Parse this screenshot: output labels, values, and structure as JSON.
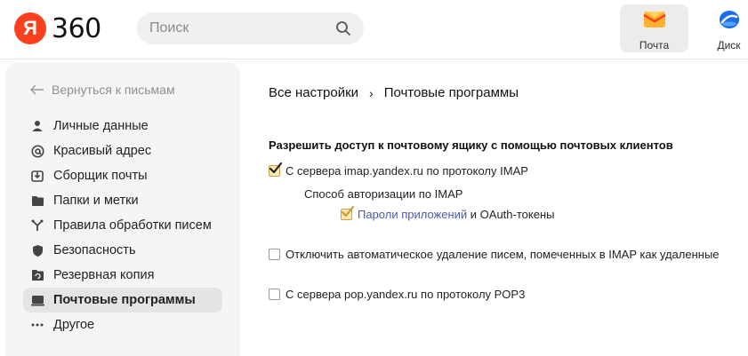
{
  "header": {
    "logo_letter": "Я",
    "logo_text": "360",
    "search_placeholder": "Поиск",
    "apps": [
      {
        "label": "Почта",
        "icon": "mail-icon"
      },
      {
        "label": "Диск",
        "icon": "disk-icon"
      }
    ]
  },
  "sidebar": {
    "back_label": "Вернуться к письмам",
    "items": [
      {
        "label": "Личные данные",
        "icon": "person-icon"
      },
      {
        "label": "Красивый адрес",
        "icon": "at-icon"
      },
      {
        "label": "Сборщик почты",
        "icon": "inbox-download-icon"
      },
      {
        "label": "Папки и метки",
        "icon": "folder-icon"
      },
      {
        "label": "Правила обработки писем",
        "icon": "rules-fork-icon"
      },
      {
        "label": "Безопасность",
        "icon": "shield-icon"
      },
      {
        "label": "Резервная копия",
        "icon": "backup-folder-icon"
      },
      {
        "label": "Почтовые программы",
        "icon": "mail-client-icon",
        "active": true
      },
      {
        "label": "Другое",
        "icon": "more-dots-icon"
      }
    ]
  },
  "main": {
    "breadcrumb": {
      "root": "Все настройки",
      "separator": "›",
      "current": "Почтовые программы"
    },
    "section_title": "Разрешить доступ к почтовому ящику с помощью почтовых клиентов",
    "imap": {
      "label": "С сервера imap.yandex.ru по протоколу IMAP",
      "checked": true
    },
    "auth_method_label": "Способ авторизации по IMAP",
    "app_passwords": {
      "link_text": "Пароли приложений",
      "rest_text": " и OAuth-токены",
      "checked": true
    },
    "disable_autodelete": {
      "label": "Отключить автоматическое удаление писем, помеченных в IMAP как удаленные",
      "checked": false
    },
    "pop3": {
      "label": "С сервера pop.yandex.ru по протоколу POP3",
      "checked": false
    }
  },
  "colors": {
    "brand_red": "#fc3f1d",
    "link": "#4a59a5",
    "sidebar_bg": "#f5f5f5",
    "active_item_bg": "#e4e4e6",
    "checkbox_checked": "#fde7b0"
  }
}
